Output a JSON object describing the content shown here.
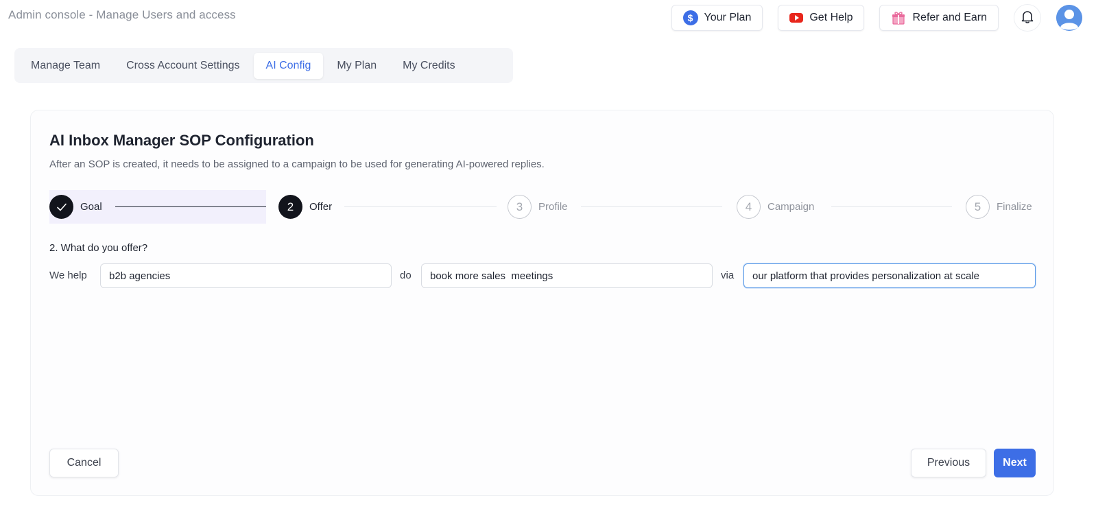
{
  "app": {
    "title": "Admin console - Manage Users and access"
  },
  "top_actions": {
    "your_plan": "Your Plan",
    "get_help": "Get Help",
    "refer_and_earn": "Refer and Earn",
    "icons": [
      "dollar-circle-icon",
      "youtube-icon",
      "gift-icon",
      "bell-icon",
      "user-avatar-icon"
    ]
  },
  "tabs": [
    {
      "label": "Manage Team",
      "active": false
    },
    {
      "label": "Cross Account Settings",
      "active": false
    },
    {
      "label": "AI Config",
      "active": true
    },
    {
      "label": "My Plan",
      "active": false
    },
    {
      "label": "My Credits",
      "active": false
    }
  ],
  "card": {
    "title": "AI Inbox Manager SOP Configuration",
    "subtitle": "After an SOP is created, it needs to be assigned to a campaign to be used for generating AI-powered replies."
  },
  "stepper": {
    "steps": [
      {
        "number": "",
        "label": "Goal",
        "status": "done"
      },
      {
        "number": "2",
        "label": "Offer",
        "status": "current"
      },
      {
        "number": "3",
        "label": "Profile",
        "status": "todo"
      },
      {
        "number": "4",
        "label": "Campaign",
        "status": "todo"
      },
      {
        "number": "5",
        "label": "Finalize",
        "status": "todo"
      }
    ]
  },
  "offer": {
    "question": "2. What do you offer?",
    "prefix_we_help": "We help",
    "connector_do": "do",
    "connector_via": "via",
    "who_value": "b2b agencies",
    "what_value": "book more sales  meetings",
    "how_value": "our platform that provides personalization at scale"
  },
  "footer": {
    "cancel": "Cancel",
    "previous": "Previous",
    "next": "Next"
  },
  "colors": {
    "accent": "#3d6ee6",
    "step_dark": "#12141c",
    "highlight": "#f2f0fc",
    "youtube_red": "#e8261c",
    "gift_pink": "#e96a9c"
  }
}
